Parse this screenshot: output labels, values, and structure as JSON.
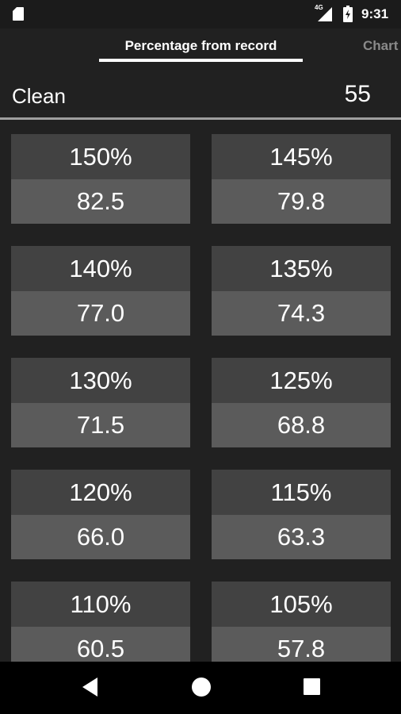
{
  "status_bar": {
    "network_type": "4G",
    "time": "9:31",
    "icons": [
      "sd-card-icon",
      "signal-icon",
      "battery-charging-icon"
    ]
  },
  "tabs": [
    {
      "label": "Percentage from record",
      "active": true
    },
    {
      "label": "Chart",
      "active": false
    }
  ],
  "exercise": {
    "name": "Clean",
    "record": "55"
  },
  "percentages": [
    {
      "percent": "150%",
      "value": "82.5"
    },
    {
      "percent": "145%",
      "value": "79.8"
    },
    {
      "percent": "140%",
      "value": "77.0"
    },
    {
      "percent": "135%",
      "value": "74.3"
    },
    {
      "percent": "130%",
      "value": "71.5"
    },
    {
      "percent": "125%",
      "value": "68.8"
    },
    {
      "percent": "120%",
      "value": "66.0"
    },
    {
      "percent": "115%",
      "value": "63.3"
    },
    {
      "percent": "110%",
      "value": "60.5"
    },
    {
      "percent": "105%",
      "value": "57.8"
    }
  ],
  "nav_bar": {
    "icons": [
      "back-icon",
      "home-icon",
      "recent-apps-icon"
    ]
  },
  "colors": {
    "background": "#212121",
    "card_top": "#424242",
    "card_bottom": "#5b5b5b",
    "divider": "#9e9e9e",
    "inactive_tab": "#8a8a8a"
  }
}
